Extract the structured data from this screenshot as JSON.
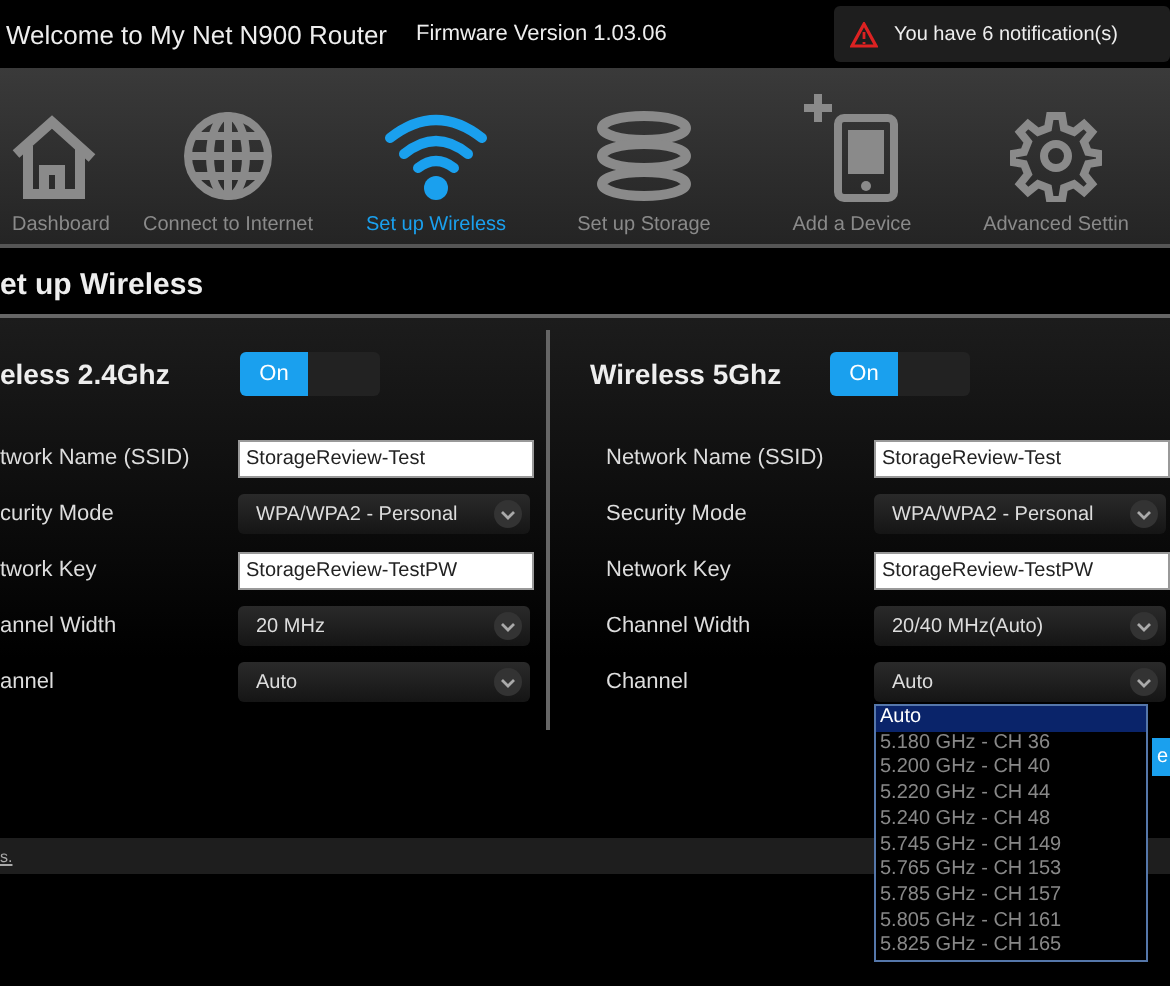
{
  "header": {
    "title": "Welcome to My Net N900 Router",
    "firmware": "Firmware Version 1.03.06",
    "notification": "You have 6 notification(s)"
  },
  "nav": [
    {
      "label": "Dashboard",
      "kind": "home",
      "selected": false
    },
    {
      "label": "Connect to Internet",
      "kind": "globe",
      "selected": false
    },
    {
      "label": "Set up Wireless",
      "kind": "wifi",
      "selected": true
    },
    {
      "label": "Set up Storage",
      "kind": "storage",
      "selected": false
    },
    {
      "label": "Add a Device",
      "kind": "device",
      "selected": false
    },
    {
      "label": "Advanced Settin",
      "kind": "gear",
      "selected": false
    }
  ],
  "page_title": "et up Wireless",
  "panels": [
    {
      "heading": "eless 2.4Ghz",
      "toggle": {
        "label": "On",
        "on": true
      },
      "fields": [
        {
          "label": "twork Name (SSID)",
          "kind": "text",
          "value": "StorageReview-Test"
        },
        {
          "label": "curity Mode",
          "kind": "select",
          "value": "WPA/WPA2 - Personal"
        },
        {
          "label": "twork Key",
          "kind": "text",
          "value": "StorageReview-TestPW"
        },
        {
          "label": "annel Width",
          "kind": "select",
          "value": "20 MHz"
        },
        {
          "label": "annel",
          "kind": "select",
          "value": "Auto"
        }
      ]
    },
    {
      "heading": "Wireless 5Ghz",
      "toggle": {
        "label": "On",
        "on": true
      },
      "fields": [
        {
          "label": "Network Name (SSID)",
          "kind": "text",
          "value": "StorageReview-Test"
        },
        {
          "label": "Security Mode",
          "kind": "select",
          "value": "WPA/WPA2 - Personal"
        },
        {
          "label": "Network Key",
          "kind": "text",
          "value": "StorageReview-TestPW"
        },
        {
          "label": "Channel Width",
          "kind": "select",
          "value": "20/40 MHz(Auto)"
        },
        {
          "label": "Channel",
          "kind": "select",
          "value": "Auto",
          "options": [
            {
              "label": "Auto",
              "selected": true
            },
            {
              "label": "5.180 GHz - CH 36",
              "selected": false
            },
            {
              "label": "5.200 GHz - CH 40",
              "selected": false
            },
            {
              "label": "5.220 GHz - CH 44",
              "selected": false
            },
            {
              "label": "5.240 GHz - CH 48",
              "selected": false
            },
            {
              "label": "5.745 GHz - CH 149",
              "selected": false
            },
            {
              "label": "5.765 GHz - CH 153",
              "selected": false
            },
            {
              "label": "5.785 GHz - CH 157",
              "selected": false
            },
            {
              "label": "5.805 GHz - CH 161",
              "selected": false
            },
            {
              "label": "5.825 GHz - CH 165",
              "selected": false
            }
          ]
        }
      ]
    }
  ],
  "save_button": "e",
  "footer": {
    "link": "s."
  }
}
